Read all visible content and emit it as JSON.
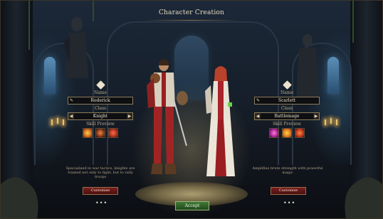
{
  "title": "Character Creation",
  "left": {
    "name_label": "Name",
    "name_value": "Roderick",
    "class_label": "Class",
    "class_value": "Knight",
    "skill_label": "Skill Preview",
    "skills": [
      "sword-strike-icon",
      "battering-ram-icon",
      "rage-icon"
    ],
    "description": "Specialised in war tactics, knights are trained not only to fight, but to rally troops",
    "customize_label": "Customise",
    "more_label": "•••"
  },
  "right": {
    "name_label": "Name",
    "name_value": "Scarlett",
    "class_label": "Class",
    "class_value": "Battlemage",
    "skill_label": "Skill Preview",
    "skills": [
      "mind-blast-icon",
      "fireball-icon",
      "burning-strike-icon"
    ],
    "description": "Amplifies brute strength with powerful magic",
    "customize_label": "Customise",
    "more_label": "•••"
  },
  "accept_label": "Accept",
  "colors": {
    "accent": "#8a7652",
    "accept_button": "#3f7a35",
    "customize_button": "#7a1e1e"
  }
}
